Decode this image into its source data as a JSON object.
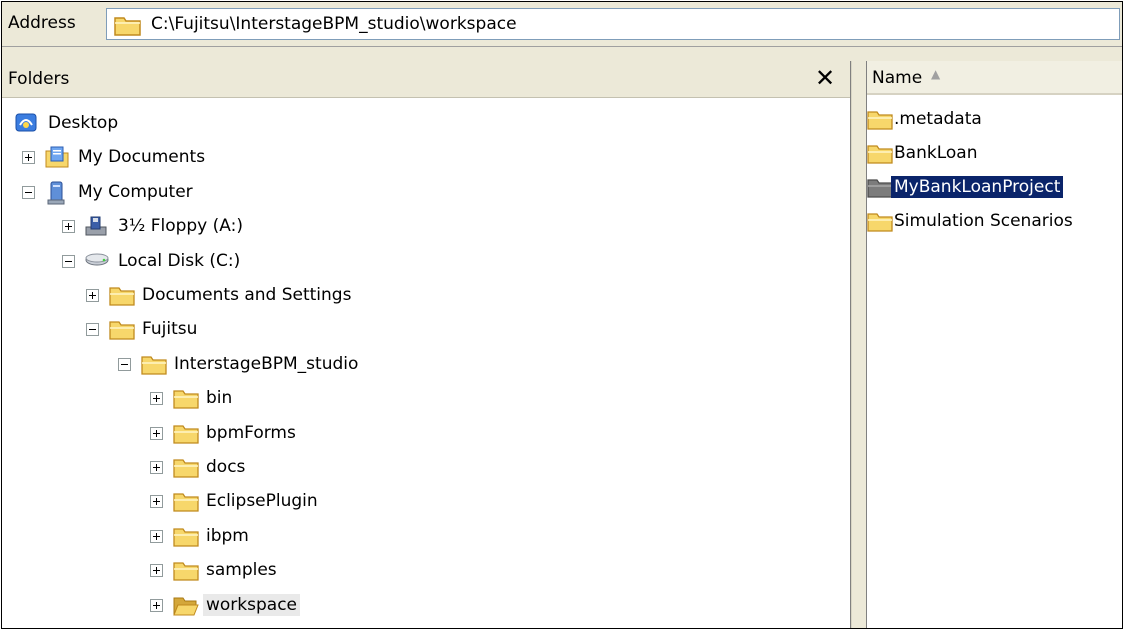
{
  "address": {
    "label": "Address",
    "path": "C:\\Fujitsu\\InterstageBPM_studio\\workspace"
  },
  "folders_pane": {
    "title": "Folders",
    "close_glyph": "✕"
  },
  "tree": [
    {
      "label": "Desktop",
      "icon": "desktop-icon",
      "level": 0,
      "expander": "none"
    },
    {
      "label": "My Documents",
      "icon": "documents-icon",
      "level": 0,
      "expander": "plus"
    },
    {
      "label": "My Computer",
      "icon": "computer-icon",
      "level": 0,
      "expander": "minus"
    },
    {
      "label": "3½ Floppy (A:)",
      "icon": "floppy-icon",
      "level": 1,
      "expander": "plus"
    },
    {
      "label": "Local Disk (C:)",
      "icon": "disk-icon",
      "level": 1,
      "expander": "minus"
    },
    {
      "label": "Documents and Settings",
      "icon": "folder-icon",
      "level": 2,
      "expander": "plus"
    },
    {
      "label": "Fujitsu",
      "icon": "folder-icon",
      "level": 2,
      "expander": "minus"
    },
    {
      "label": "InterstageBPM_studio",
      "icon": "folder-icon",
      "level": 3,
      "expander": "minus"
    },
    {
      "label": "bin",
      "icon": "folder-icon",
      "level": 4,
      "expander": "plus"
    },
    {
      "label": "bpmForms",
      "icon": "folder-icon",
      "level": 4,
      "expander": "plus"
    },
    {
      "label": "docs",
      "icon": "folder-icon",
      "level": 4,
      "expander": "plus"
    },
    {
      "label": "EclipsePlugin",
      "icon": "folder-icon",
      "level": 4,
      "expander": "plus"
    },
    {
      "label": "ibpm",
      "icon": "folder-icon",
      "level": 4,
      "expander": "plus"
    },
    {
      "label": "samples",
      "icon": "folder-icon",
      "level": 4,
      "expander": "plus"
    },
    {
      "label": "workspace",
      "icon": "folder-open-icon",
      "level": 4,
      "expander": "plus",
      "selected": true
    }
  ],
  "contents": {
    "column_header": "Name",
    "sort_glyph": "▲",
    "items": [
      {
        "label": ".metadata",
        "icon": "folder-icon"
      },
      {
        "label": "BankLoan",
        "icon": "folder-icon"
      },
      {
        "label": "MyBankLoanProject",
        "icon": "folder-icon",
        "selected": true
      },
      {
        "label": "Simulation Scenarios",
        "icon": "folder-icon"
      }
    ]
  },
  "colors": {
    "folder": "#f7d76b",
    "folder_dark": "#d4a73a",
    "selection": "#0a246a",
    "chrome": "#ece9d8"
  }
}
